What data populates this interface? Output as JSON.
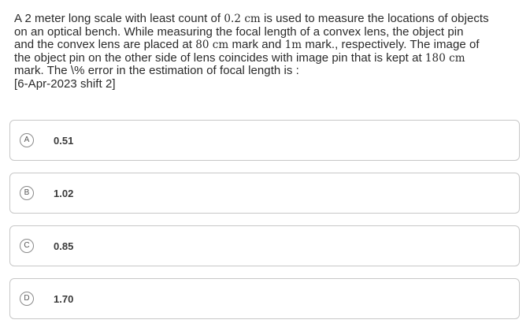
{
  "question": {
    "line1": [
      "A 2 meter long scale with least count of ",
      "0.2 cm",
      " is used to measure the locations of objects"
    ],
    "line2": "on an optical bench. While measuring the focal length of a convex lens, the object pin",
    "line3": [
      "and the convex lens are placed at ",
      "80 cm",
      " mark and ",
      "1m",
      " mark., respectively. The image of"
    ],
    "line4": [
      "the object pin on the other side of lens coincides with image pin that is kept at ",
      "180 cm"
    ],
    "line5": "mark. The \\% error in the estimation of focal length is :",
    "line6": "[6-Apr-2023 shift 2]"
  },
  "options": [
    {
      "letter": "A",
      "value": "0.51"
    },
    {
      "letter": "B",
      "value": "1.02"
    },
    {
      "letter": "C",
      "value": "0.85"
    },
    {
      "letter": "D",
      "value": "1.70"
    }
  ]
}
